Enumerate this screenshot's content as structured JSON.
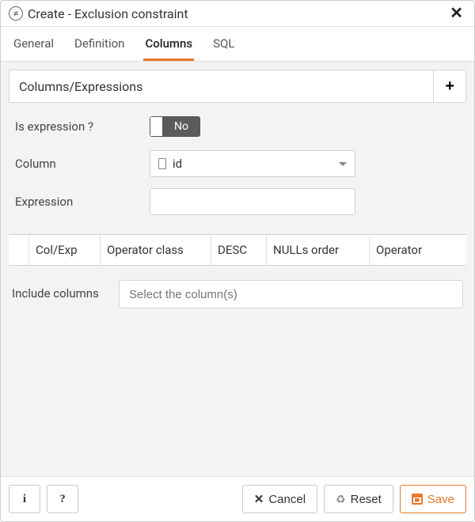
{
  "header": {
    "icon_name": "exclusion-constraint-icon",
    "title": "Create - Exclusion constraint"
  },
  "tabs": [
    {
      "id": "general",
      "label": "General"
    },
    {
      "id": "definition",
      "label": "Definition"
    },
    {
      "id": "columns",
      "label": "Columns",
      "active": true
    },
    {
      "id": "sql",
      "label": "SQL"
    }
  ],
  "section": {
    "title": "Columns/Expressions",
    "add_tooltip": "Add"
  },
  "form": {
    "is_expression_label": "Is expression ?",
    "is_expression_value": false,
    "is_expression_display": "No",
    "column_label": "Column",
    "column_value": "id",
    "expression_label": "Expression",
    "expression_value": ""
  },
  "grid": {
    "columns": [
      "",
      "Col/Exp",
      "Operator class",
      "DESC",
      "NULLs order",
      "Operator"
    ],
    "rows": []
  },
  "include": {
    "label": "Include columns",
    "placeholder": "Select the column(s)",
    "values": []
  },
  "footer": {
    "info": "i",
    "help": "?",
    "cancel": "Cancel",
    "reset": "Reset",
    "save": "Save"
  }
}
